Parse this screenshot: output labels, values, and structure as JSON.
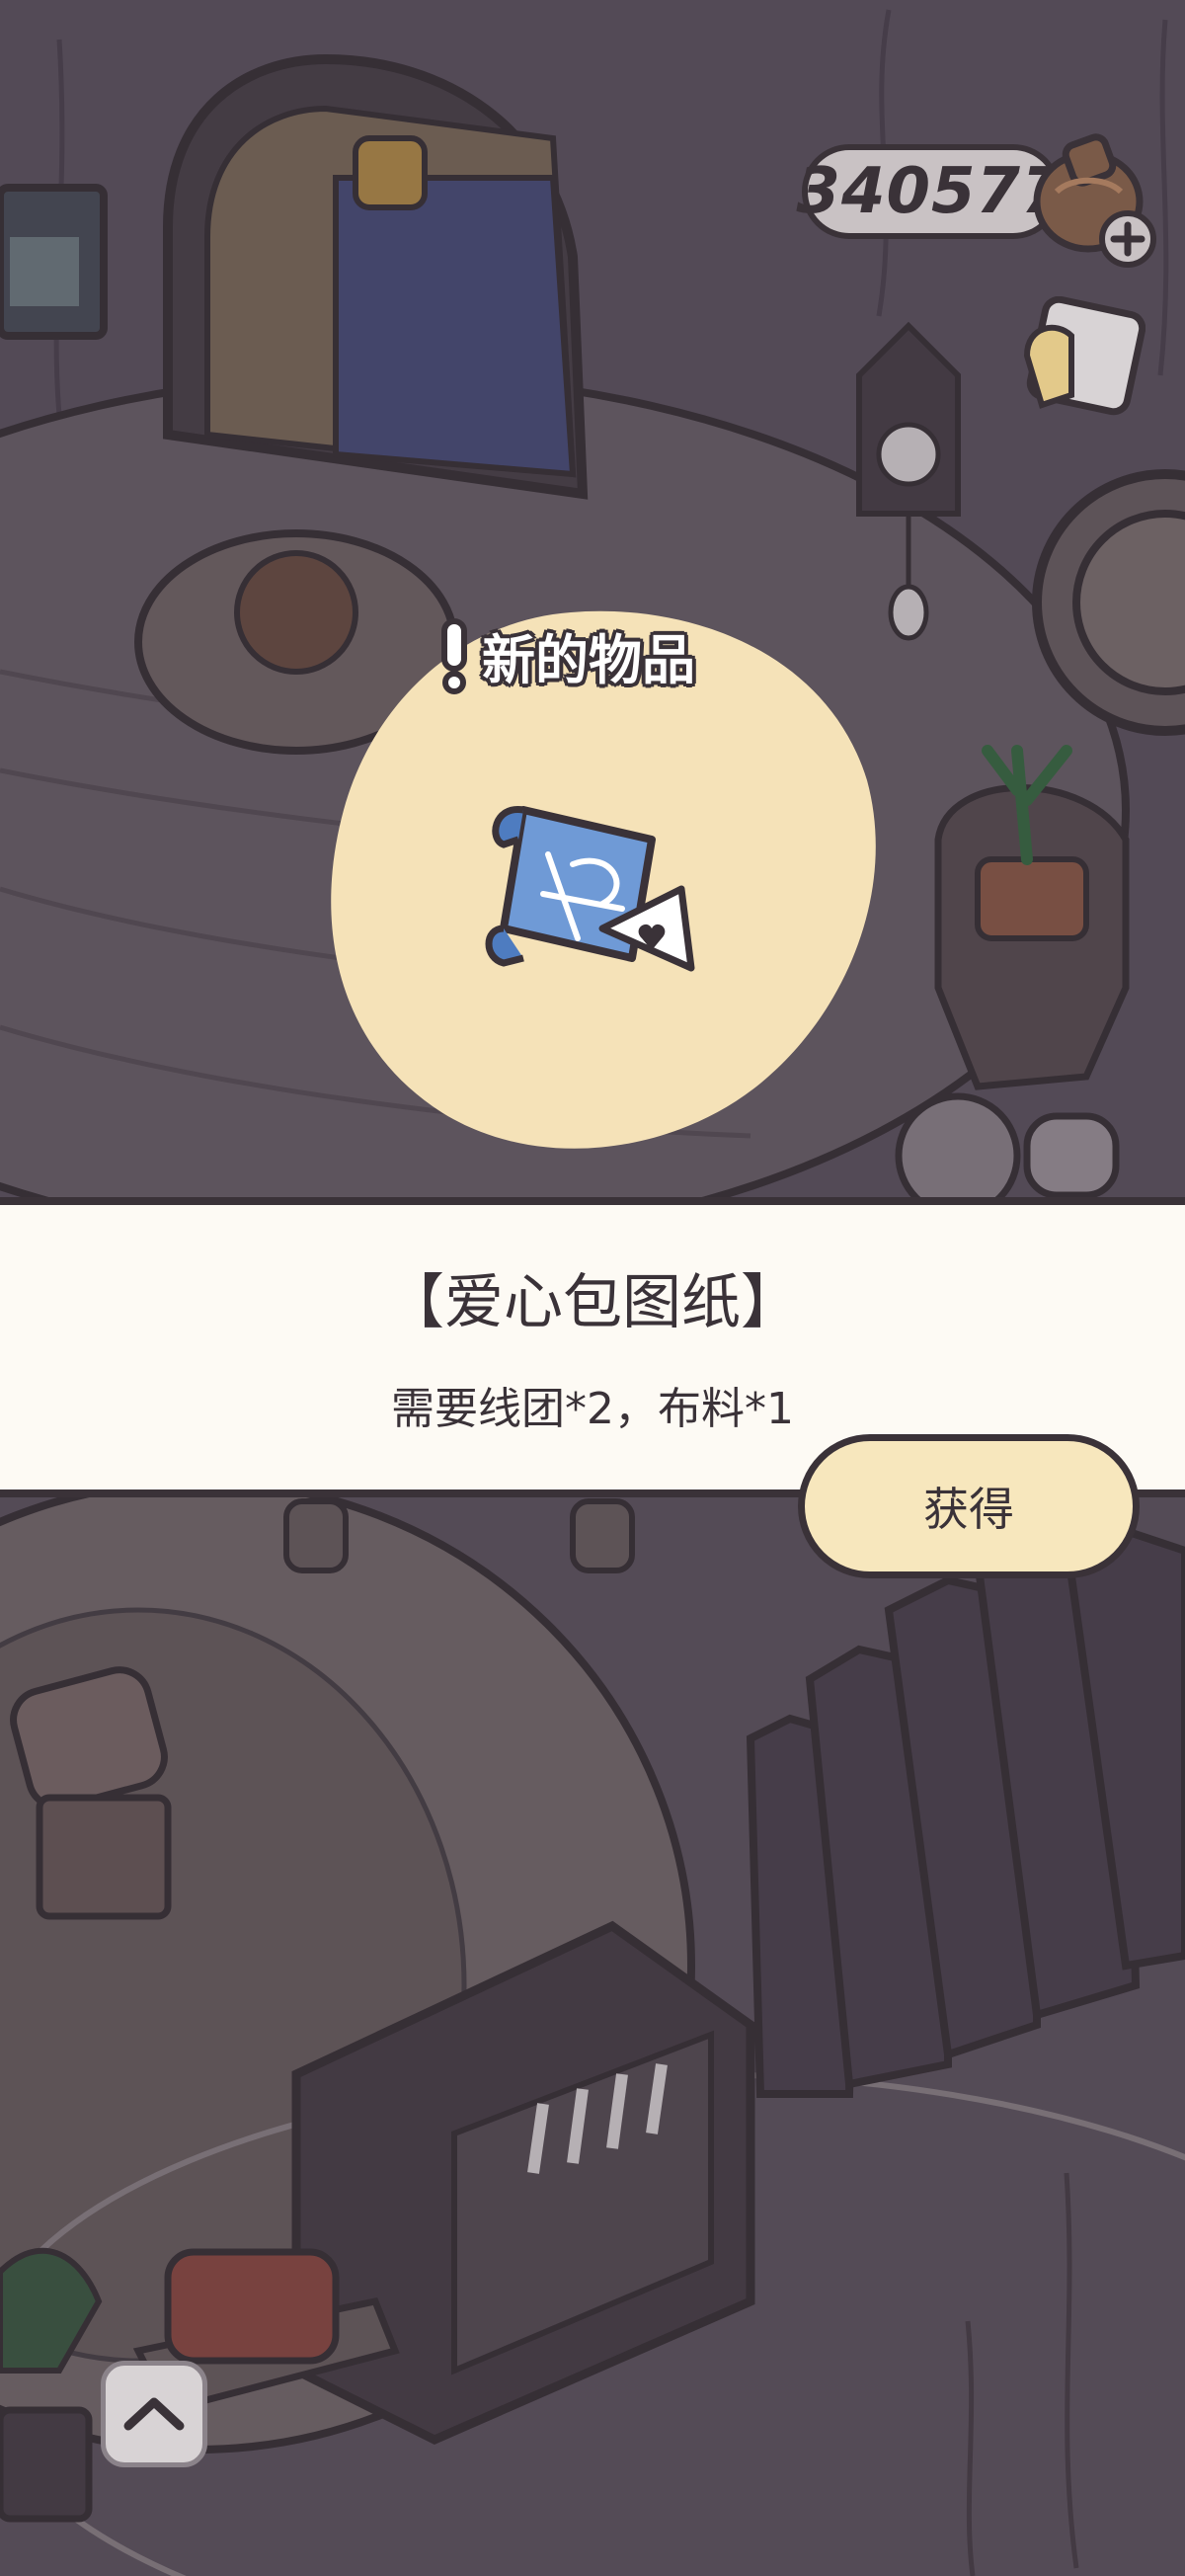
{
  "hud": {
    "coin_count": "340577",
    "coin_add_icon": "coin-bag-plus-icon",
    "mailbox_icon": "mailbox-icon"
  },
  "popup": {
    "alert_icon": "exclamation-icon",
    "title": "新的物品",
    "item_icon": "blueprint-scroll-icon"
  },
  "banner": {
    "item_name": "【爱心包图纸】",
    "requirement": "需要线团*2，布料*1"
  },
  "actions": {
    "obtain_label": "获得",
    "expand_icon": "chevron-up-icon"
  },
  "colors": {
    "background": "#5e5460",
    "outline": "#3a3238",
    "popup_blob": "#f5e2b8",
    "banner": "#fdfaf4",
    "button": "#f7e7bd"
  }
}
